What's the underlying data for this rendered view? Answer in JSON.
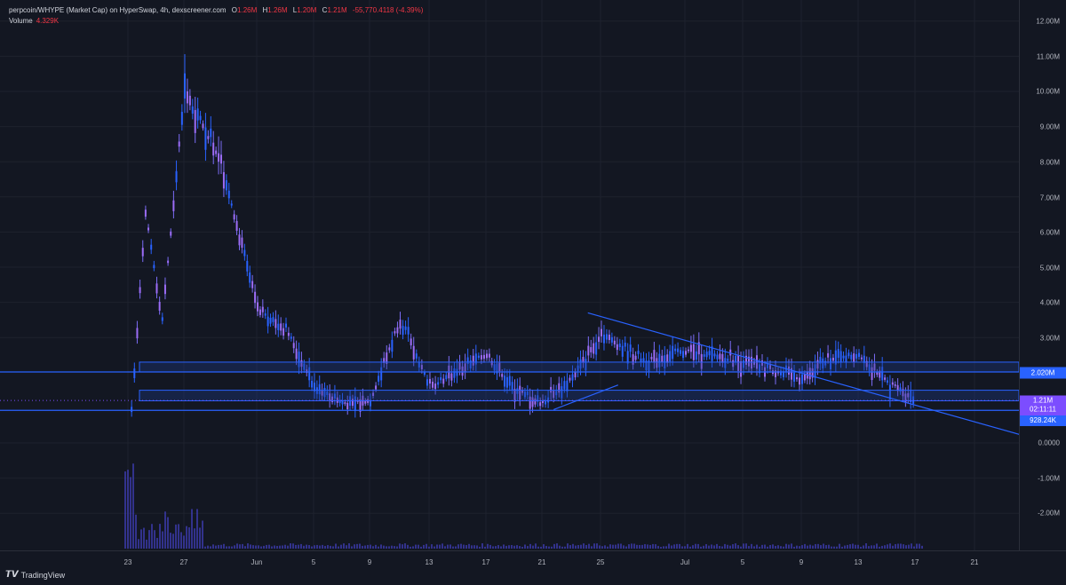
{
  "legend": {
    "symbol": "perpcoin/WHYPE (Market Cap) on HyperSwap, 4h, dexscreener.com",
    "o_label": "O",
    "o_value": "1.26M",
    "h_label": "H",
    "h_value": "1.26M",
    "l_label": "L",
    "l_value": "1.20M",
    "c_label": "C",
    "c_value": "1.21M",
    "change": "-55,770.4118 (-4.39%)",
    "volume_label": "Volume",
    "volume_value": "4.329K"
  },
  "y_axis": {
    "ticks": [
      "12.00M",
      "11.00M",
      "10.00M",
      "9.00M",
      "8.00M",
      "7.00M",
      "6.00M",
      "5.00M",
      "4.00M",
      "3.00M",
      "0.0000",
      "-1.00M",
      "-2.00M"
    ]
  },
  "x_axis": {
    "ticks": [
      "23",
      "27",
      "Jun",
      "5",
      "9",
      "13",
      "17",
      "21",
      "25",
      "Jul",
      "5",
      "9",
      "13",
      "17",
      "21"
    ]
  },
  "price_tags": {
    "level_1": "2.020M",
    "current_price": "1.21M",
    "countdown": "02:11:11",
    "level_2": "928.24K"
  },
  "branding": {
    "name": "TradingView",
    "icon": "tradingview-logo-icon"
  },
  "colors": {
    "background": "#131722",
    "line": "#2962ff",
    "zone_fill": "#1e3a8a",
    "candle": "#7b6cf6",
    "current_tag": "#7c4dff"
  },
  "chart_data": {
    "type": "candlestick",
    "title": "perpcoin/WHYPE (Market Cap) on HyperSwap, 4h, dexscreener.com",
    "ylim": [
      -2500000,
      12500000
    ],
    "y_unit": "market cap",
    "x": [
      "23",
      "27",
      "Jun",
      "5",
      "9",
      "13",
      "17",
      "21",
      "25",
      "Jul",
      "5",
      "9",
      "13",
      "17"
    ],
    "close_path": [
      [
        "23",
        0.05,
        1.0
      ],
      [
        "23",
        0.3,
        6.5
      ],
      [
        "23",
        0.6,
        3.5
      ],
      [
        "27",
        0.0,
        10.0
      ],
      [
        "27",
        0.5,
        8.0
      ],
      [
        "Jun",
        0.0,
        3.8
      ],
      [
        "Jun",
        0.5,
        3.2
      ],
      [
        "5",
        0.0,
        1.6
      ],
      [
        "5",
        0.5,
        1.1
      ],
      [
        "9",
        0.0,
        1.2
      ],
      [
        "9",
        0.5,
        3.5
      ],
      [
        "13",
        0.0,
        1.6
      ],
      [
        "17",
        0.0,
        2.5
      ],
      [
        "17",
        0.5,
        1.5
      ],
      [
        "21",
        0.0,
        1.1
      ],
      [
        "21",
        0.6,
        2.0
      ],
      [
        "25",
        0.0,
        3.1
      ],
      [
        "25",
        0.5,
        2.3
      ],
      [
        "Jul",
        0.0,
        2.6
      ],
      [
        "5",
        0.0,
        2.3
      ],
      [
        "9",
        0.0,
        1.8
      ],
      [
        "9",
        0.5,
        2.4
      ],
      [
        "13",
        0.0,
        2.5
      ],
      [
        "13",
        0.5,
        1.7
      ],
      [
        "17",
        0.0,
        1.21
      ]
    ],
    "horizontal_levels": [
      2.02,
      0.928
    ],
    "zones": [
      [
        2.02,
        2.3
      ],
      [
        1.2,
        1.5
      ]
    ],
    "trendlines": [
      {
        "from": [
          "25",
          -0.15,
          3.7
        ],
        "to": [
          "21",
          1.3,
          0.0
        ]
      },
      {
        "from": [
          "21",
          0.2,
          0.95
        ],
        "to": [
          "21",
          1.3,
          1.65
        ]
      }
    ],
    "volume_spikes": [
      [
        "23",
        0.1,
        1.0
      ],
      [
        "27",
        0.0,
        0.4
      ]
    ]
  }
}
